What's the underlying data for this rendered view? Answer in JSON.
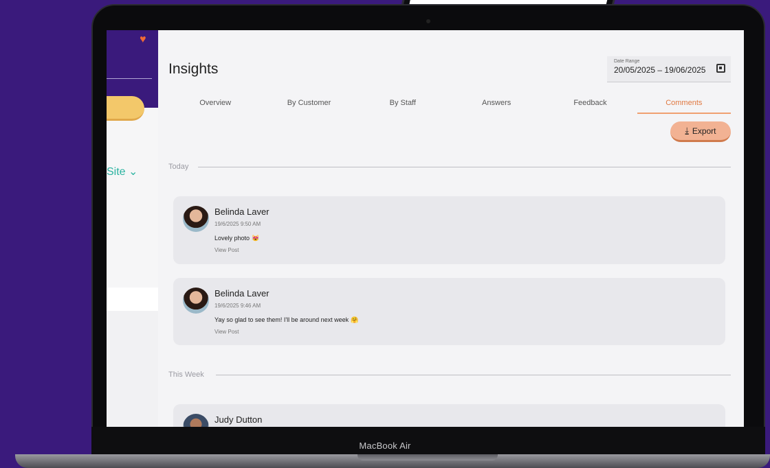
{
  "device": {
    "brand_label": "MacBook Air"
  },
  "sidebar": {
    "site_label": "Site ⌄"
  },
  "header": {
    "title": "Insights",
    "date_range": {
      "label": "Date Range",
      "value": "20/05/2025 – 19/06/2025"
    }
  },
  "tabs": [
    {
      "label": "Overview",
      "active": false
    },
    {
      "label": "By Customer",
      "active": false
    },
    {
      "label": "By Staff",
      "active": false
    },
    {
      "label": "Answers",
      "active": false
    },
    {
      "label": "Feedback",
      "active": false
    },
    {
      "label": "Comments",
      "active": true
    }
  ],
  "export": {
    "label": "Export"
  },
  "sections": [
    {
      "label": "Today",
      "comments": [
        {
          "name": "Belinda Laver",
          "timestamp": "19/6/2025 9:50 AM",
          "message": "Lovely photo",
          "emoji": "😻",
          "link": "View Post"
        },
        {
          "name": "Belinda Laver",
          "timestamp": "19/6/2025 9:46 AM",
          "message": "Yay so glad to see them! I'll be around next week",
          "emoji": "🤗",
          "link": "View Post"
        }
      ]
    },
    {
      "label": "This Week",
      "comments": [
        {
          "name": "Judy Dutton"
        }
      ]
    }
  ],
  "help": {
    "label": "?"
  },
  "colors": {
    "brand_purple": "#3a1a7c",
    "accent_orange": "#e07840",
    "teal": "#2ab3a0",
    "yellow": "#f3c86a"
  }
}
